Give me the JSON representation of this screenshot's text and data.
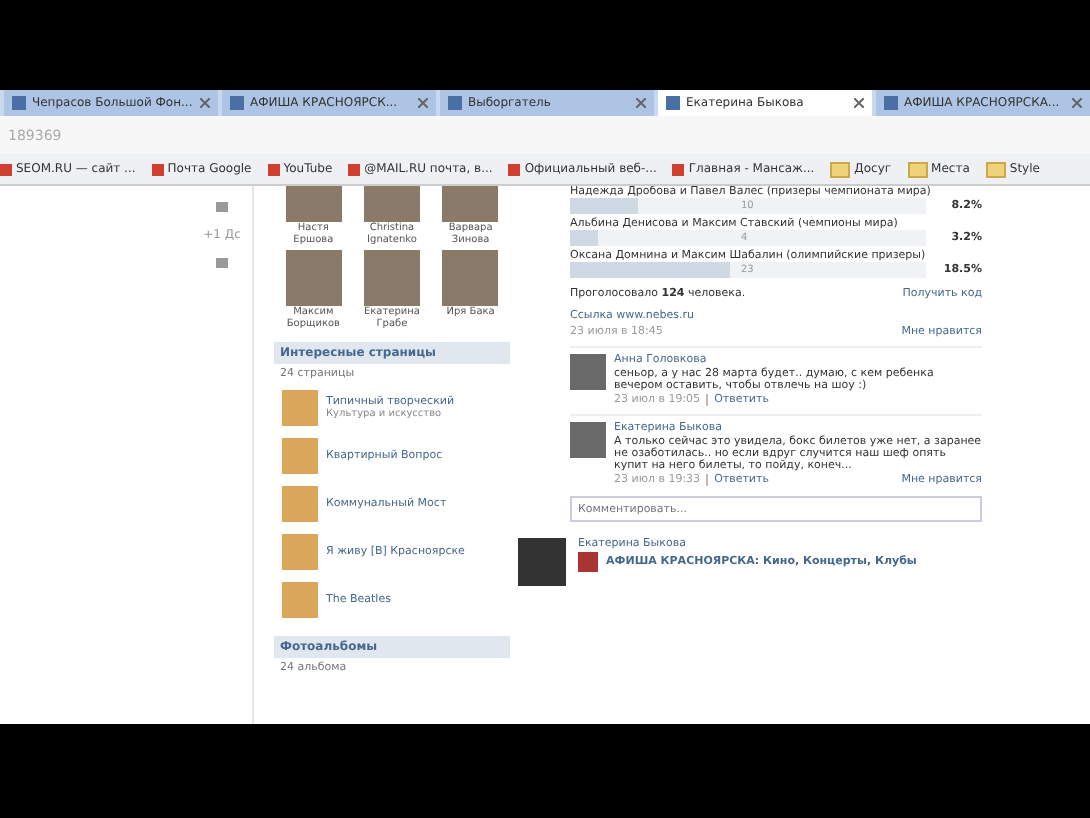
{
  "tabs": [
    {
      "label": "Чепрасов Большой Фон...",
      "selected": false
    },
    {
      "label": "АФИША КРАСНОЯРСК...",
      "selected": false
    },
    {
      "label": "Выборгатель",
      "selected": false
    },
    {
      "label": "Екатерина Быкова",
      "selected": true
    },
    {
      "label": "АФИША КРАСНОЯРСКА...",
      "selected": false
    }
  ],
  "address": "189369",
  "bookmarks": [
    {
      "label": "SEOM.RU — сайт ...",
      "kind": "page"
    },
    {
      "label": "Почта Google",
      "kind": "page"
    },
    {
      "label": "YouTube",
      "kind": "page"
    },
    {
      "label": "@MAIL.RU почта, в...",
      "kind": "page"
    },
    {
      "label": "Официальный веб-...",
      "kind": "page"
    },
    {
      "label": "Главная - Мансаж...",
      "kind": "page"
    },
    {
      "label": "Досуг",
      "kind": "folder"
    },
    {
      "label": "Места",
      "kind": "folder"
    },
    {
      "label": "Style",
      "kind": "folder"
    }
  ],
  "side_counter": "+1 Дс",
  "friends": [
    {
      "name": "Настя Ершова"
    },
    {
      "name": "Christina Ignatenko"
    },
    {
      "name": "Варвара Зинова"
    },
    {
      "name": "Максим Борщиков"
    },
    {
      "name": "Екатерина Грабе"
    },
    {
      "name": "Иря Бака"
    }
  ],
  "pages_section": {
    "title": "Интересные страницы",
    "count": "24 страницы",
    "items": [
      {
        "name": "Типичный творческий",
        "subtitle": "Культура и искусство"
      },
      {
        "name": "Квартирный Вопрос"
      },
      {
        "name": "Коммунальный Мост"
      },
      {
        "name": "Я живу [В] Красноярске"
      },
      {
        "name": "The Beatles"
      }
    ]
  },
  "albums_section": {
    "title": "Фотоальбомы",
    "count": "24 альбома"
  },
  "poll": {
    "options": [
      {
        "text": "Надежда Дробова и Павел Валес (призеры чемпионата мира)",
        "votes": "10",
        "percent": "8.2%",
        "level": 0.19
      },
      {
        "text": "Альбина Денисова и Максим Ставский (чемпионы мира)",
        "votes": "4",
        "percent": "3.2%",
        "level": 0.08
      },
      {
        "text": "Оксана Домнина и Максим Шабалин (олимпийские призеры)",
        "votes": "23",
        "percent": "18.5%",
        "level": 0.45
      }
    ],
    "total": "Проголосовало **124** человека.",
    "get_code": "Получить код"
  },
  "post_link": "Ссылка www.nebes.ru",
  "post_date": "23 июля в 18:45",
  "post_like": "Мне нравится",
  "comments": [
    {
      "author": "Анна Головкова",
      "text": "сеньор, а у нас 28 марта будет.. думаю, с кем ребенка вечером оставить, чтобы отвлечь на шоу :)",
      "date": "23 июл в 19:05",
      "reply": "Ответить"
    },
    {
      "author": "Екатерина Быкова",
      "text": "А только сейчас это увидела, бокс билетов уже нет, а заранее не озаботилась.. но если вдруг случится наш шеф опять купит на него билеты, то пойду, конеч...",
      "date": "23 июл в 19:33",
      "reply": "Ответить",
      "like": "Мне нравится"
    }
  ],
  "comment_field": {
    "placeholder": "Комментировать..."
  },
  "next_post": {
    "author": "Екатерина Быкова",
    "text": "АФИША КРАСНОЯРСКА: Кино, Концерты, Клубы"
  }
}
